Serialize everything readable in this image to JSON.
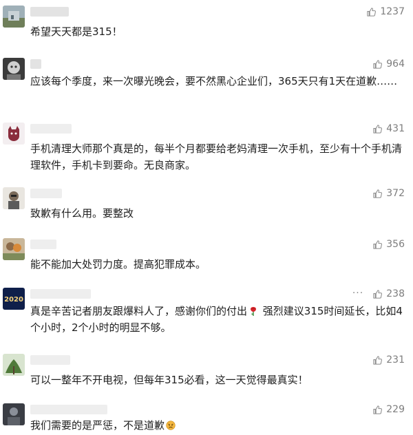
{
  "comments": [
    {
      "likes": "1237",
      "text": "希望天天都是315！"
    },
    {
      "likes": "964",
      "text": "应该每个季度，来一次曝光晚会，要不然黑心企业们，365天只有1天在道歉……"
    },
    {
      "likes": "431",
      "text": "手机清理大师那个真是的，每半个月都要给老妈清理一次手机，至少有十个手机清理软件，手机卡到要命。无良商家。"
    },
    {
      "likes": "372",
      "text": "致歉有什么用。要整改"
    },
    {
      "likes": "356",
      "text": "能不能加大处罚力度。提高犯罪成本。"
    },
    {
      "likes": "238",
      "text": "真是辛苦记者朋友跟爆料人了，感谢你们的付出",
      "text_after": " 强烈建议315时间延长，比如4个小时，2个小时的明显不够。",
      "more": "···",
      "avatar_text": "2020"
    },
    {
      "likes": "231",
      "text": "可以一整年不开电视，但每年315必看，这一天觉得最真实！"
    },
    {
      "likes": "229",
      "text": "我们需要的是严惩，不是道歉"
    }
  ],
  "colors": {
    "like": "#7d7d7d",
    "text": "#1e1e1e",
    "name_blur": "#e3e3e3"
  },
  "icons": {
    "like": "thumbs-up-icon",
    "rose": "rose-emoji-icon",
    "angry": "angry-face-emoji-icon"
  }
}
